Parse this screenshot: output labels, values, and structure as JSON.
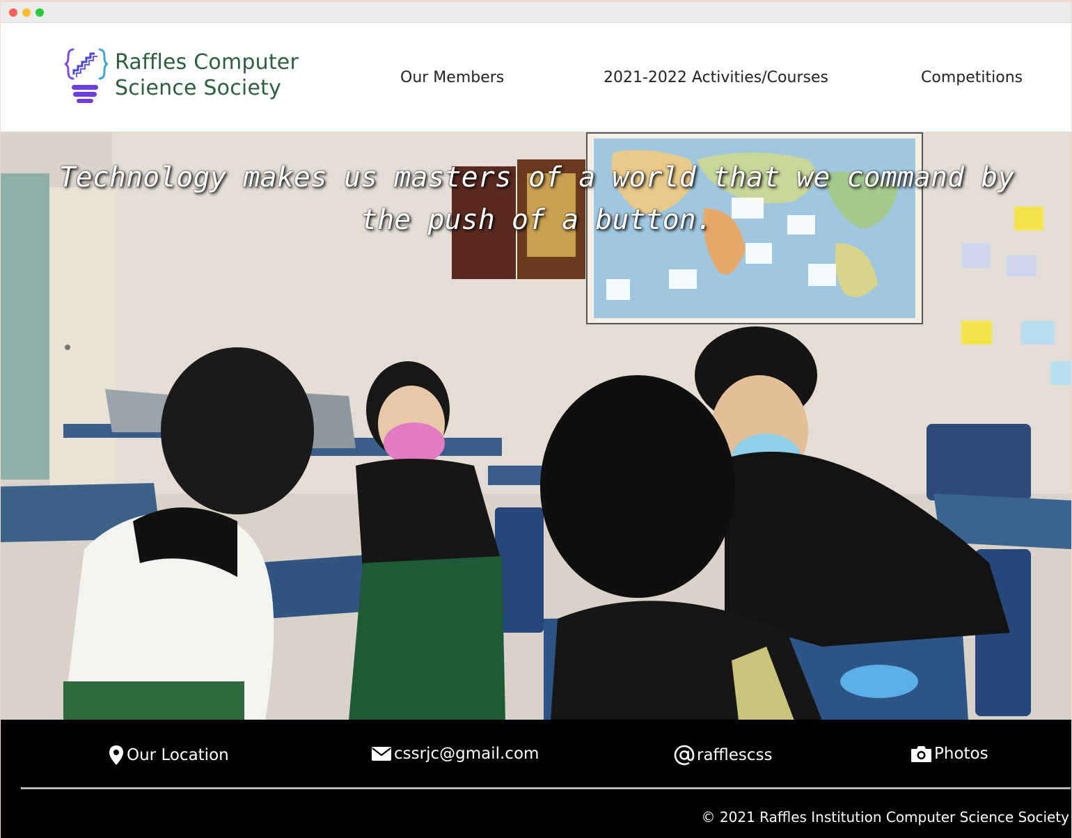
{
  "brand": {
    "line1": "Raffles Computer",
    "line2": "Science Society"
  },
  "nav": {
    "members": "Our Members",
    "activities": "2021-2022 Activities/Courses",
    "competitions": "Competitions"
  },
  "hero": {
    "quote": "Technology makes us masters of a world that we command by the push of a button."
  },
  "footer": {
    "location": "Our Location",
    "email": "cssrjc@gmail.com",
    "social": "rafflescss",
    "photos": "Photos",
    "copyright": "© 2021 Raffles Institution Computer Science Society"
  }
}
